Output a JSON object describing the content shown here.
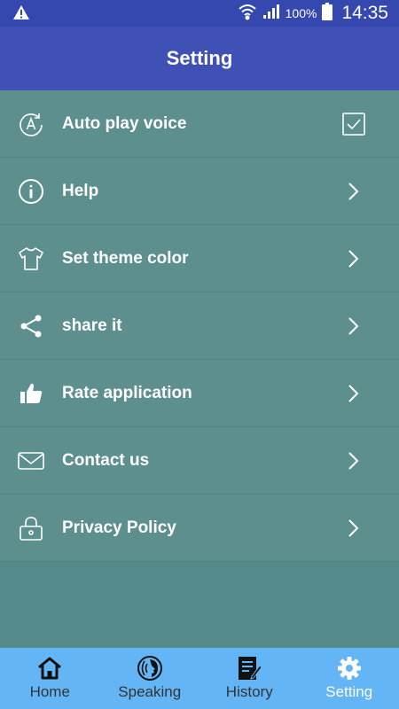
{
  "status_bar": {
    "battery_percent": "100%",
    "time": "14:35",
    "icons": [
      "warning-icon",
      "wifi-icon",
      "signal-icon",
      "battery-icon"
    ]
  },
  "appbar": {
    "title": "Setting"
  },
  "settings": {
    "items": [
      {
        "label": "Auto play voice",
        "icon": "auto-voice-icon",
        "control": "checkbox",
        "checked": true
      },
      {
        "label": "Help",
        "icon": "info-icon",
        "control": "chevron"
      },
      {
        "label": "Set theme color",
        "icon": "shirt-icon",
        "control": "chevron"
      },
      {
        "label": "share it",
        "icon": "share-icon",
        "control": "chevron"
      },
      {
        "label": "Rate application",
        "icon": "thumbs-up-icon",
        "control": "chevron"
      },
      {
        "label": "Contact us",
        "icon": "mail-icon",
        "control": "chevron"
      },
      {
        "label": "Privacy Policy",
        "icon": "lock-icon",
        "control": "chevron"
      }
    ]
  },
  "bottom_nav": {
    "items": [
      {
        "label": "Home",
        "icon": "home-icon",
        "active": false
      },
      {
        "label": "Speaking",
        "icon": "speaking-icon",
        "active": false
      },
      {
        "label": "History",
        "icon": "history-icon",
        "active": false
      },
      {
        "label": "Setting",
        "icon": "gear-icon",
        "active": true
      }
    ]
  },
  "colors": {
    "status_bar": "#3548b0",
    "app_bar": "#3f51b5",
    "list_background": "#5e8f8f",
    "page_background": "#558a8a",
    "bottom_nav": "#64b5f6",
    "nav_active": "#ffffff",
    "nav_inactive": "#333333"
  }
}
